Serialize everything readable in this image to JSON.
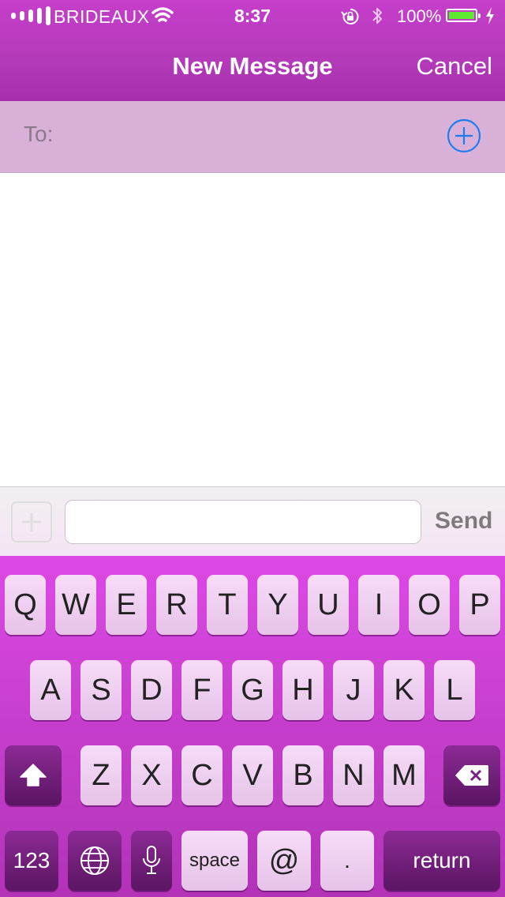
{
  "status_bar": {
    "carrier": "BRIDEAUX",
    "time": "8:37",
    "battery_percent": "100%",
    "battery_level": 1.0,
    "signal_bars": 5,
    "icons": [
      "signal-icon",
      "wifi-icon",
      "rotation-lock-icon",
      "bluetooth-icon",
      "battery-icon",
      "charging-bolt-icon"
    ]
  },
  "nav": {
    "title": "New Message",
    "cancel_label": "Cancel"
  },
  "recipient": {
    "label": "To:",
    "add_icon": "plus-circle-icon"
  },
  "compose": {
    "attach_icon": "plus-icon",
    "message_value": "",
    "send_label": "Send"
  },
  "keyboard": {
    "row1": [
      "Q",
      "W",
      "E",
      "R",
      "T",
      "Y",
      "U",
      "I",
      "O",
      "P"
    ],
    "row2": [
      "A",
      "S",
      "D",
      "F",
      "G",
      "H",
      "J",
      "K",
      "L"
    ],
    "row3": [
      "Z",
      "X",
      "C",
      "V",
      "B",
      "N",
      "M"
    ],
    "shift_icon": "shift-icon",
    "delete_icon": "backspace-icon",
    "numbers_label": "123",
    "globe_icon": "globe-icon",
    "mic_icon": "microphone-icon",
    "space_label": "space",
    "at_label": "@",
    "period_label": ".",
    "return_label": "return"
  },
  "colors": {
    "header": "#b33ab8",
    "keyboard": "#c43dcb",
    "accent_blue": "#1f7df0",
    "to_row": "#d8b0d8"
  }
}
